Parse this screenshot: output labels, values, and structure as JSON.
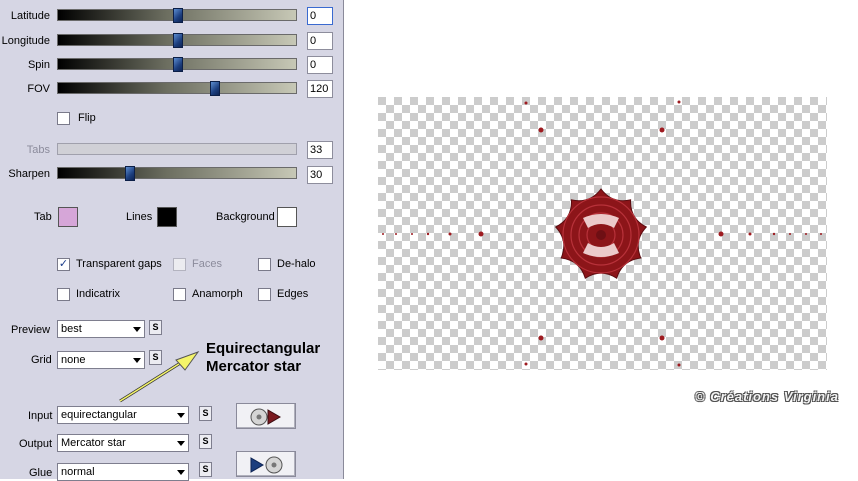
{
  "sliders": [
    {
      "label": "Latitude",
      "value": "0",
      "level": 0.5
    },
    {
      "label": "Longitude",
      "value": "0",
      "level": 0.5
    },
    {
      "label": "Spin",
      "value": "0",
      "level": 0.5
    },
    {
      "label": "FOV",
      "value": "120",
      "level": 0.655
    },
    {
      "label": "Tabs",
      "value": "33",
      "level": 0.0
    },
    {
      "label": "Sharpen",
      "value": "30",
      "level": 0.3
    }
  ],
  "flip": {
    "label": "Flip",
    "checked": false
  },
  "colors": {
    "tab": {
      "label": "Tab",
      "color": "#d6a6d8"
    },
    "lines": {
      "label": "Lines",
      "color": "#000000"
    },
    "background": {
      "label": "Background",
      "color": "#ffffff"
    }
  },
  "options": [
    {
      "label": "Transparent gaps",
      "checked": true
    },
    {
      "label": "Faces",
      "checked": false
    },
    {
      "label": "De-halo",
      "checked": false
    },
    {
      "label": "Indicatrix",
      "checked": false
    },
    {
      "label": "Anamorph",
      "checked": false
    },
    {
      "label": "Edges",
      "checked": false
    }
  ],
  "preview": {
    "label": "Preview",
    "value": "best"
  },
  "grid": {
    "label": "Grid",
    "value": "none"
  },
  "input": {
    "label": "Input",
    "value": "equirectangular"
  },
  "output": {
    "label": "Output",
    "value": "Mercator star"
  },
  "glue": {
    "label": "Glue",
    "value": "normal"
  },
  "s_label": "S",
  "annotation": {
    "line1": "Equirectangular",
    "line2": "Mercator star"
  },
  "watermark": "© Créations Virginia",
  "accent_color": "#9e1b20"
}
